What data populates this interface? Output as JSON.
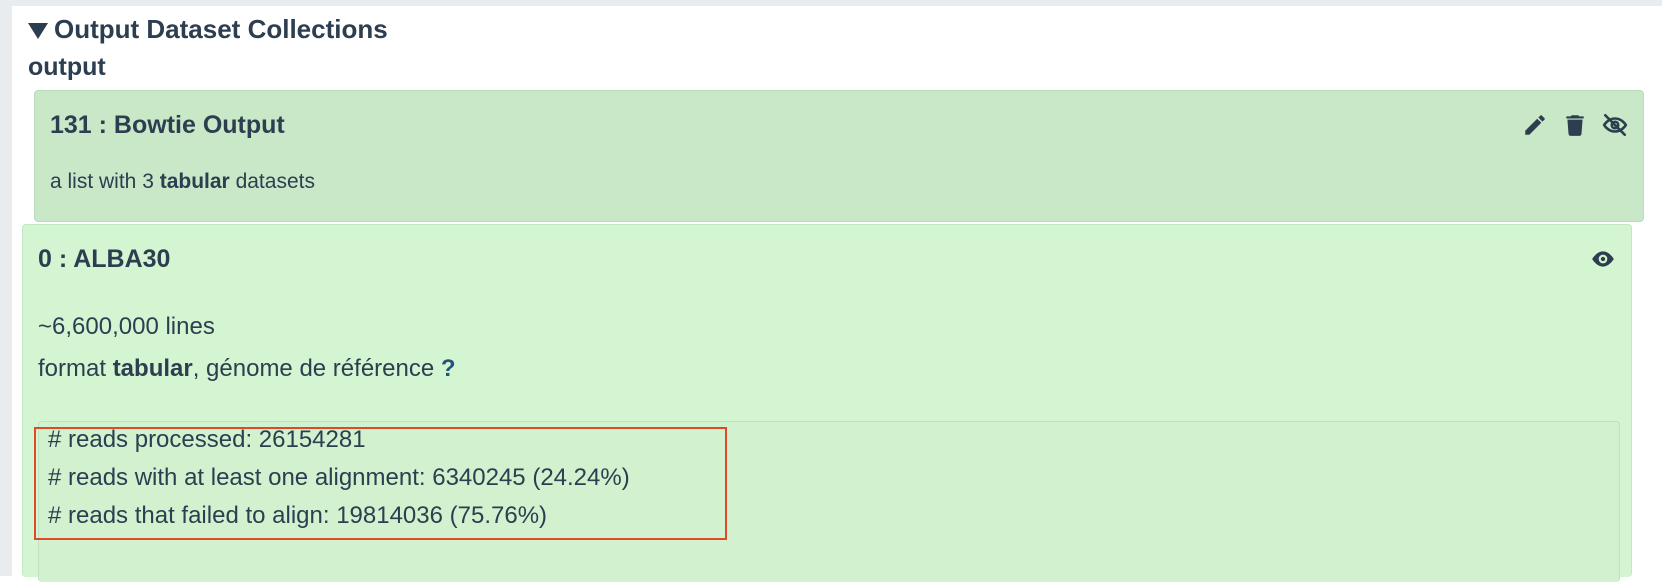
{
  "section": {
    "header": "Output Dataset Collections",
    "output_name": "output"
  },
  "collection": {
    "title": "131 : Bowtie Output",
    "description_prefix": "a list with 3 ",
    "description_format": "tabular",
    "description_suffix": " datasets",
    "icons": [
      "pencil-icon",
      "trash-icon",
      "eye-slash-icon"
    ]
  },
  "dataset": {
    "title": "0 : ALBA30",
    "lines": "~6,600,000 lines",
    "format_prefix": "format ",
    "format_value": "tabular",
    "format_sep": ",  ",
    "genome_label": "génome de référence ",
    "genome_value": "?",
    "icons": [
      "eye-icon"
    ],
    "peek": [
      "# reads processed: 26154281",
      "# reads with at least one alignment: 6340245 (24.24%)",
      "# reads that failed to align: 19814036 (75.76%)"
    ]
  },
  "colors": {
    "text": "#2c3e50",
    "collection_bg": "#c8e8c8",
    "dataset_bg": "#d4f5d1",
    "highlight": "#e0482a",
    "link": "#25537b"
  }
}
